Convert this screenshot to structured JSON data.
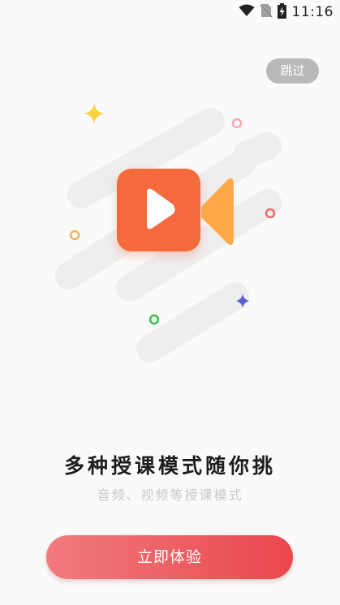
{
  "status_bar": {
    "time": "11:16",
    "icons": [
      "wifi-icon",
      "no-sim-icon",
      "battery-charging-icon"
    ]
  },
  "skip_button": {
    "label": "跳过"
  },
  "illustration": {
    "icon": "video-camera-icon",
    "colors": {
      "camera_body": "#f56b3e",
      "camera_lens": "#ffa94a",
      "play": "#ffffff"
    }
  },
  "headline": "多种授课模式随你挑",
  "subline": "音频、视频等授课模式",
  "cta_button": {
    "label": "立即体验",
    "gradient": [
      "#f07b7d",
      "#e9474d"
    ]
  }
}
